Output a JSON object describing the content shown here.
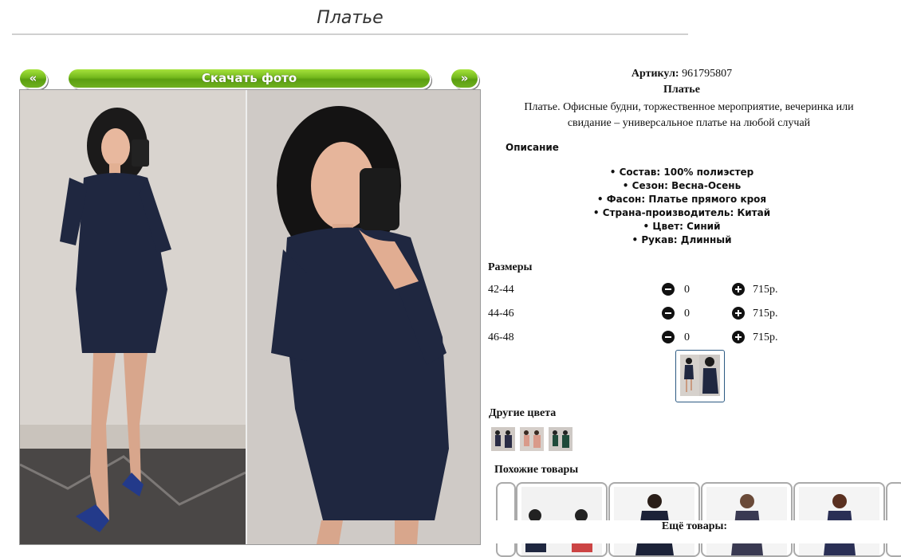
{
  "page": {
    "title": "Платье"
  },
  "nav": {
    "prev_label": "«",
    "download_label": "Скачать фото",
    "next_label": "»"
  },
  "product": {
    "article_label": "Артикул:",
    "article": "961795807",
    "name": "Платье",
    "description": "Платье. Офисные будни, торжественное мероприятие, вечеринка или свидание – универсальное платье на любой случай"
  },
  "specs": {
    "heading": "Описание",
    "items": [
      "Состав: 100% полиэстер",
      "Сезон: Весна-Осень",
      "Фасон: Платье прямого кроя",
      "Страна-производитель: Китай",
      "Цвет: Синий",
      "Рукав: Длинный"
    ]
  },
  "sizes": {
    "heading": "Размеры",
    "rows": [
      {
        "size": "42-44",
        "qty": "0",
        "price": "715р."
      },
      {
        "size": "44-46",
        "qty": "0",
        "price": "715р."
      },
      {
        "size": "46-48",
        "qty": "0",
        "price": "715р."
      }
    ]
  },
  "other_colors": {
    "heading": "Другие цвета",
    "items": [
      "navy-dress-thumb",
      "pink-dress-thumb",
      "green-dress-thumb"
    ]
  },
  "similar": {
    "heading": "Похожие товары"
  },
  "more": {
    "heading": "Ещё товары:"
  },
  "colors": {
    "accent_green": "#73b81c",
    "link_green": "#1a8a1a",
    "dress_navy": "#1f2740"
  }
}
